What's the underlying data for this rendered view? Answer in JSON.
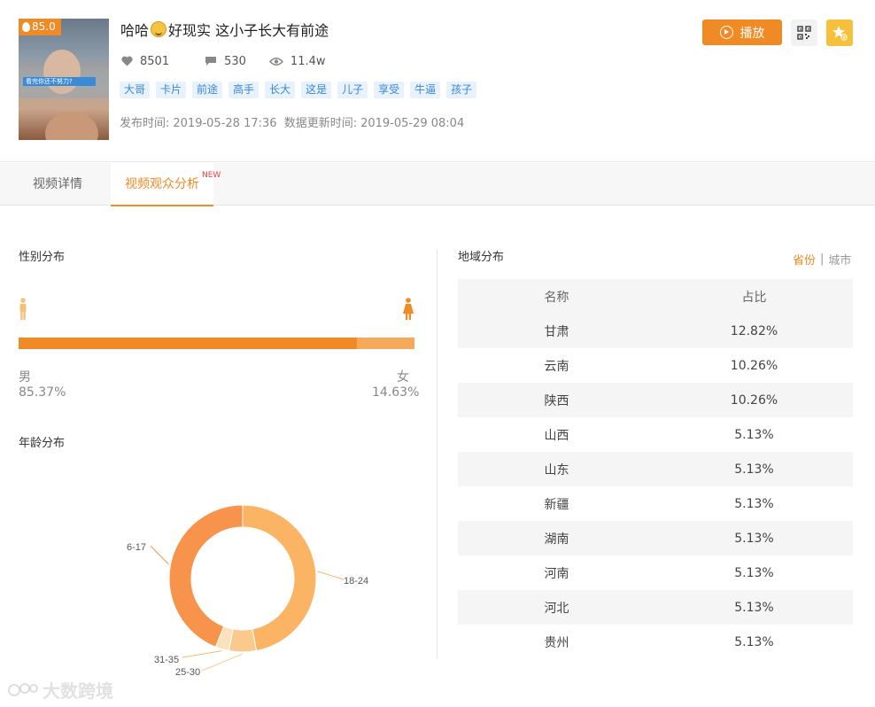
{
  "video": {
    "score": "85.0",
    "thumb_caption": "看完你还不努力?",
    "title_part1": "哈哈",
    "title_part2": "好现实 这小子长大有前途",
    "likes": "8501",
    "comments": "530",
    "views": "11.4w",
    "tags": [
      "大哥",
      "卡片",
      "前途",
      "高手",
      "长大",
      "这是",
      "儿子",
      "享受",
      "牛逼",
      "孩子"
    ],
    "publish_label": "发布时间:",
    "publish_time": "2019-05-28 17:36",
    "update_label": "数据更新时间:",
    "update_time": "2019-05-29 08:04"
  },
  "actions": {
    "play_label": "播放"
  },
  "tabs": [
    {
      "label": "视频详情"
    },
    {
      "label": "视频观众分析",
      "badge": "NEW"
    }
  ],
  "gender": {
    "title": "性别分布",
    "male_label": "男",
    "male_pct": "85.37%",
    "male_value": 85.37,
    "female_label": "女",
    "female_pct": "14.63%",
    "female_value": 14.63
  },
  "age": {
    "title": "年龄分布"
  },
  "region": {
    "title": "地域分布",
    "toggle_on": "省份",
    "toggle_sep": "|",
    "toggle_off": "城市",
    "col_name": "名称",
    "col_share": "占比",
    "rows": [
      {
        "name": "甘肃",
        "share": "12.82%"
      },
      {
        "name": "云南",
        "share": "10.26%"
      },
      {
        "name": "陕西",
        "share": "10.26%"
      },
      {
        "name": "山西",
        "share": "5.13%"
      },
      {
        "name": "山东",
        "share": "5.13%"
      },
      {
        "name": "新疆",
        "share": "5.13%"
      },
      {
        "name": "湖南",
        "share": "5.13%"
      },
      {
        "name": "河南",
        "share": "5.13%"
      },
      {
        "name": "河北",
        "share": "5.13%"
      },
      {
        "name": "贵州",
        "share": "5.13%"
      }
    ]
  },
  "watermark": "大数跨境",
  "colors": {
    "accent": "#f08a24",
    "accent_light": "#f6a95a",
    "tag_bg": "#e8f2fc",
    "tag_text": "#3a86d8"
  },
  "chart_data": {
    "type": "pie",
    "categories": [
      "18-24",
      "25-30",
      "31-35",
      "6-17"
    ],
    "values": [
      47,
      6,
      3,
      44
    ],
    "colors": [
      "#fbb464",
      "#fcc98c",
      "#fde0bc",
      "#f7934a"
    ]
  }
}
